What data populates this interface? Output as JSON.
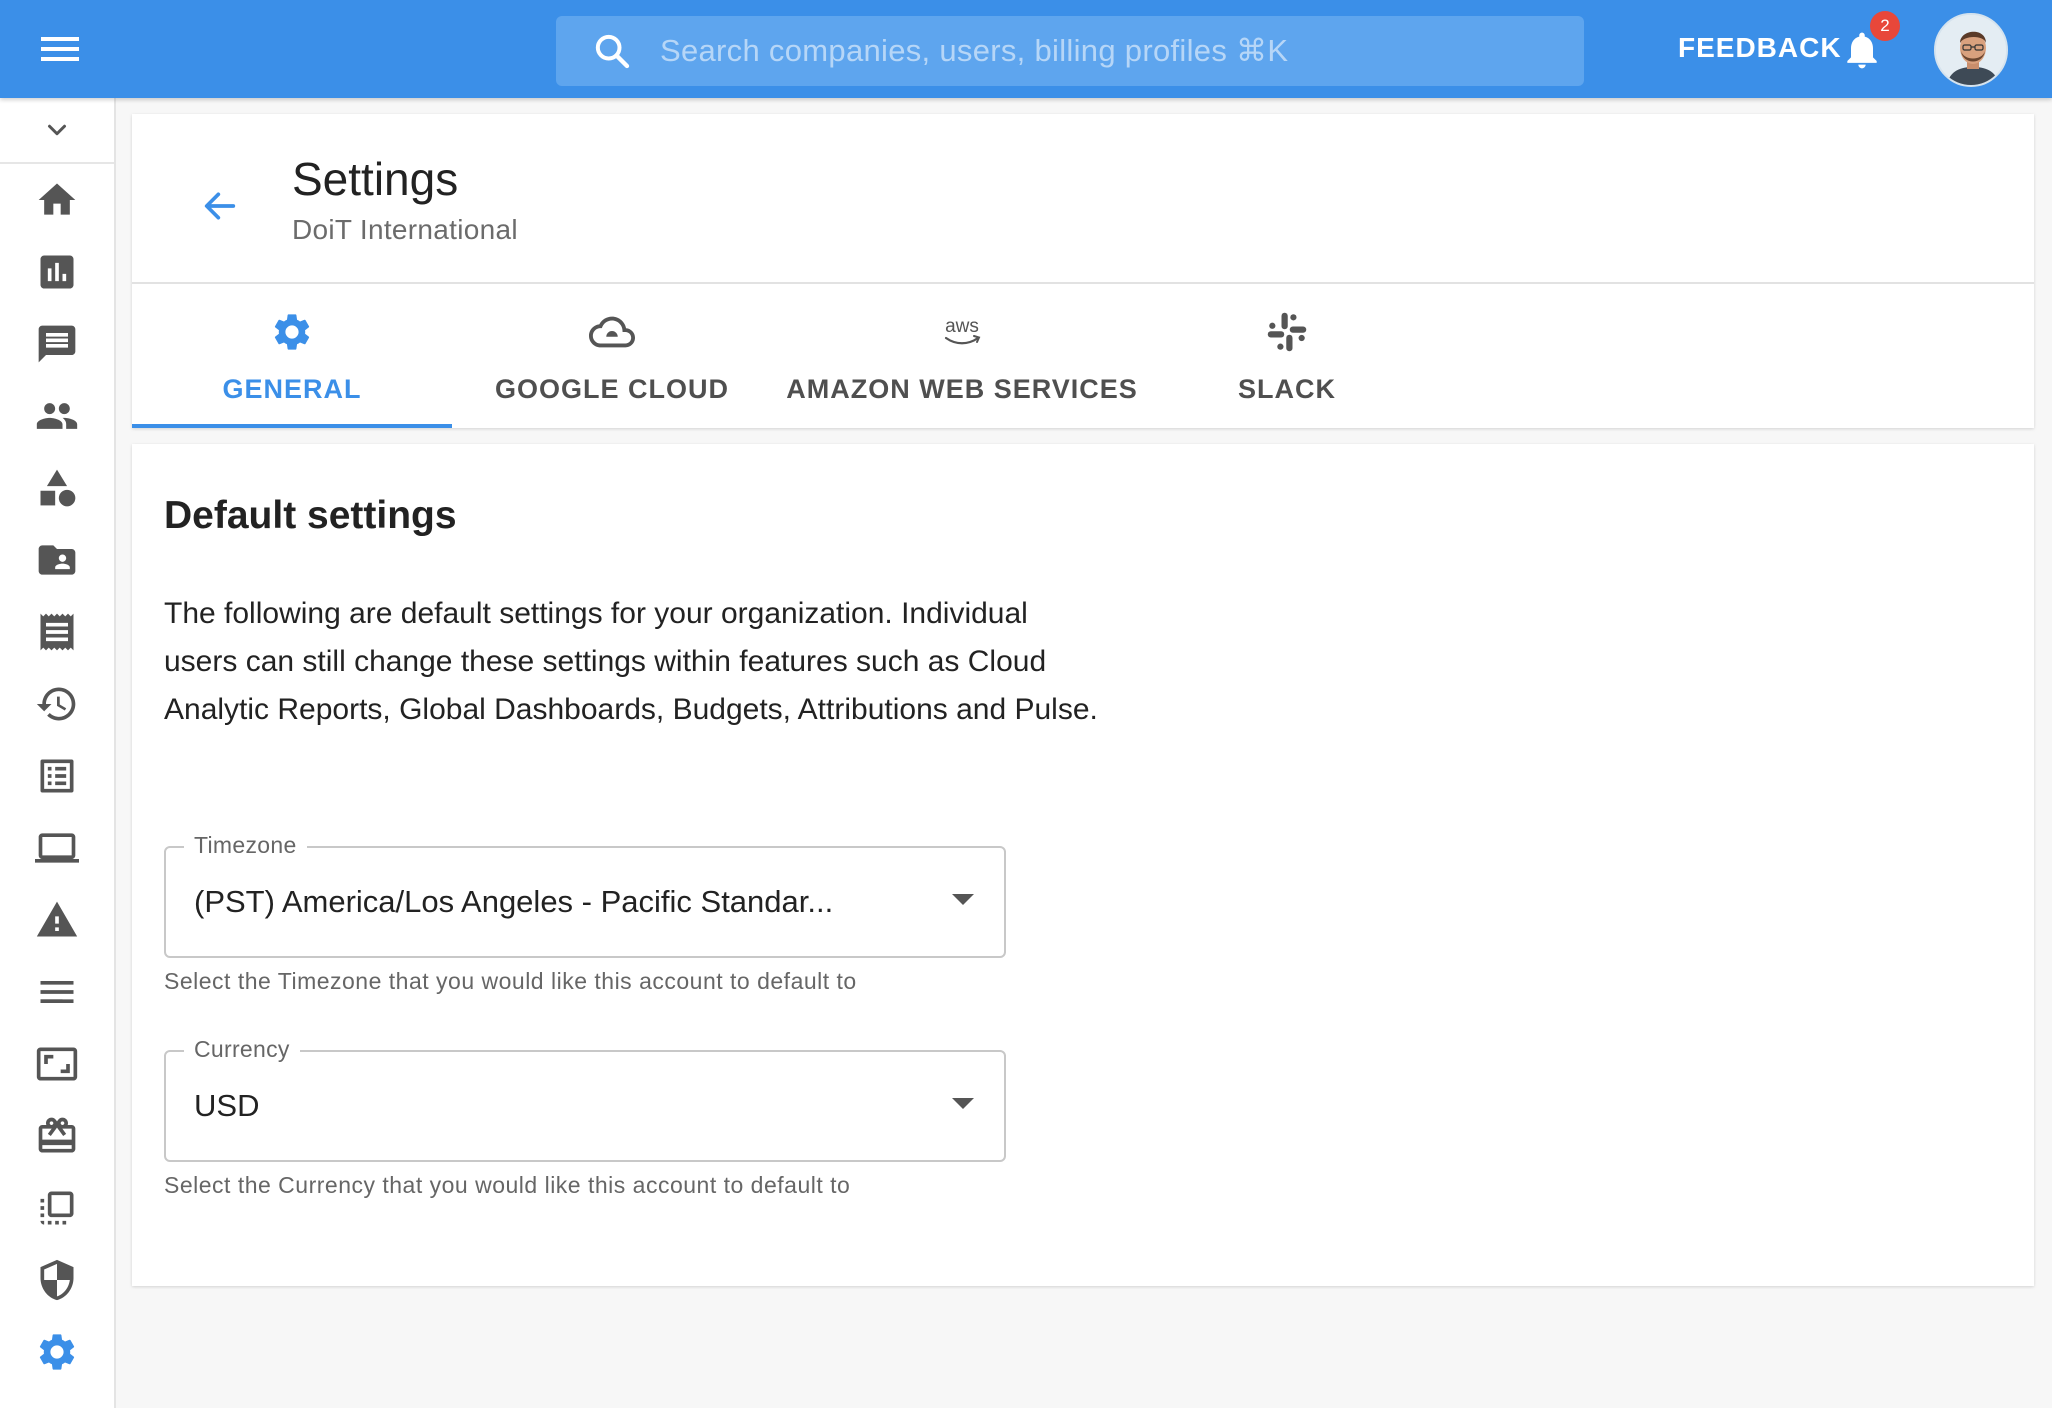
{
  "topbar": {
    "search_placeholder": "Search companies, users, billing profiles ⌘K",
    "feedback_label": "FEEDBACK",
    "notification_count": "2"
  },
  "sidebar": {
    "items": [
      {
        "icon": "home-icon"
      },
      {
        "icon": "analytics-icon"
      },
      {
        "icon": "message-icon"
      },
      {
        "icon": "people-icon"
      },
      {
        "icon": "category-icon"
      },
      {
        "icon": "folder-account-icon"
      },
      {
        "icon": "receipt-icon"
      },
      {
        "icon": "history-icon"
      },
      {
        "icon": "list-alt-icon"
      },
      {
        "icon": "laptop-icon"
      },
      {
        "icon": "warning-icon"
      },
      {
        "icon": "notes-icon"
      },
      {
        "icon": "aspect-ratio-icon"
      },
      {
        "icon": "gift-card-icon"
      },
      {
        "icon": "transform-icon"
      },
      {
        "icon": "shield-icon"
      },
      {
        "icon": "settings-icon",
        "active": true
      }
    ]
  },
  "header": {
    "title": "Settings",
    "subtitle": "DoiT International"
  },
  "tabs": [
    {
      "label": "GENERAL",
      "icon": "gear-icon",
      "active": true
    },
    {
      "label": "GOOGLE CLOUD",
      "icon": "cloud-icon",
      "active": false
    },
    {
      "label": "AMAZON WEB SERVICES",
      "icon": "aws-icon",
      "icon_text": "aws",
      "active": false
    },
    {
      "label": "SLACK",
      "icon": "slack-icon",
      "active": false
    }
  ],
  "content": {
    "section_title": "Default settings",
    "description": "The following are default settings for your organization. Individual users can still change these settings within features such as Cloud Analytic Reports, Global Dashboards, Budgets, Attributions and Pulse.",
    "timezone": {
      "label": "Timezone",
      "value": "(PST) America/Los Angeles - Pacific Standar...",
      "helper": "Select the Timezone that you would like this account to default to"
    },
    "currency": {
      "label": "Currency",
      "value": "USD",
      "helper": "Select the Currency that you would like this account to default to"
    }
  },
  "colors": {
    "brand": "#3b8fe8",
    "badge": "#e8473a",
    "icon_gray": "#555555"
  }
}
